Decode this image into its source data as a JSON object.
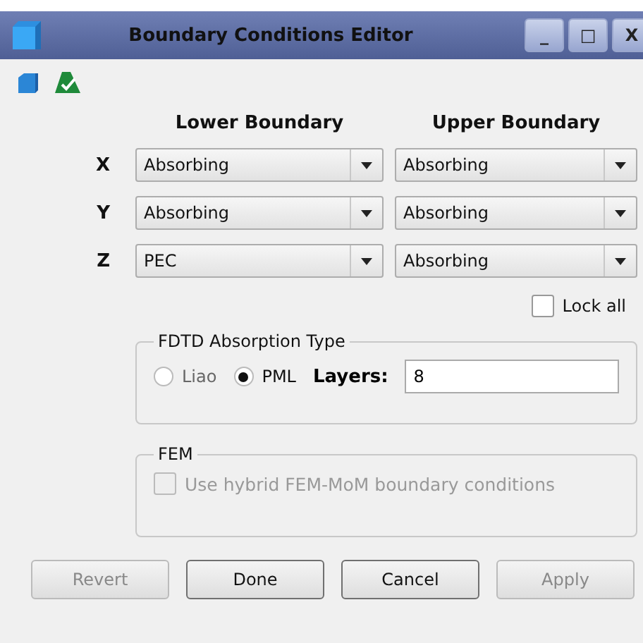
{
  "window": {
    "title": "Boundary Conditions Editor",
    "controls": [
      "_",
      "□",
      "X"
    ]
  },
  "headers": {
    "lower": "Lower Boundary",
    "upper": "Upper Boundary"
  },
  "axes": [
    {
      "label": "X",
      "lower": "Absorbing",
      "upper": "Absorbing"
    },
    {
      "label": "Y",
      "lower": "Absorbing",
      "upper": "Absorbing"
    },
    {
      "label": "Z",
      "lower": "PEC",
      "upper": "Absorbing"
    }
  ],
  "lock_all": {
    "label": "Lock all",
    "checked": false
  },
  "fdtd": {
    "title": "FDTD Absorption Type",
    "options": [
      {
        "label": "Liao",
        "selected": false
      },
      {
        "label": "PML",
        "selected": true
      }
    ],
    "layers_label": "Layers:",
    "layers_value": "8"
  },
  "fem": {
    "title": "FEM",
    "checkbox": {
      "label": "Use hybrid FEM-MoM boundary conditions",
      "checked": false,
      "disabled": true
    }
  },
  "buttons": [
    {
      "label": "Revert",
      "disabled": true
    },
    {
      "label": "Done",
      "disabled": false
    },
    {
      "label": "Cancel",
      "disabled": false
    },
    {
      "label": "Apply",
      "disabled": true
    }
  ]
}
